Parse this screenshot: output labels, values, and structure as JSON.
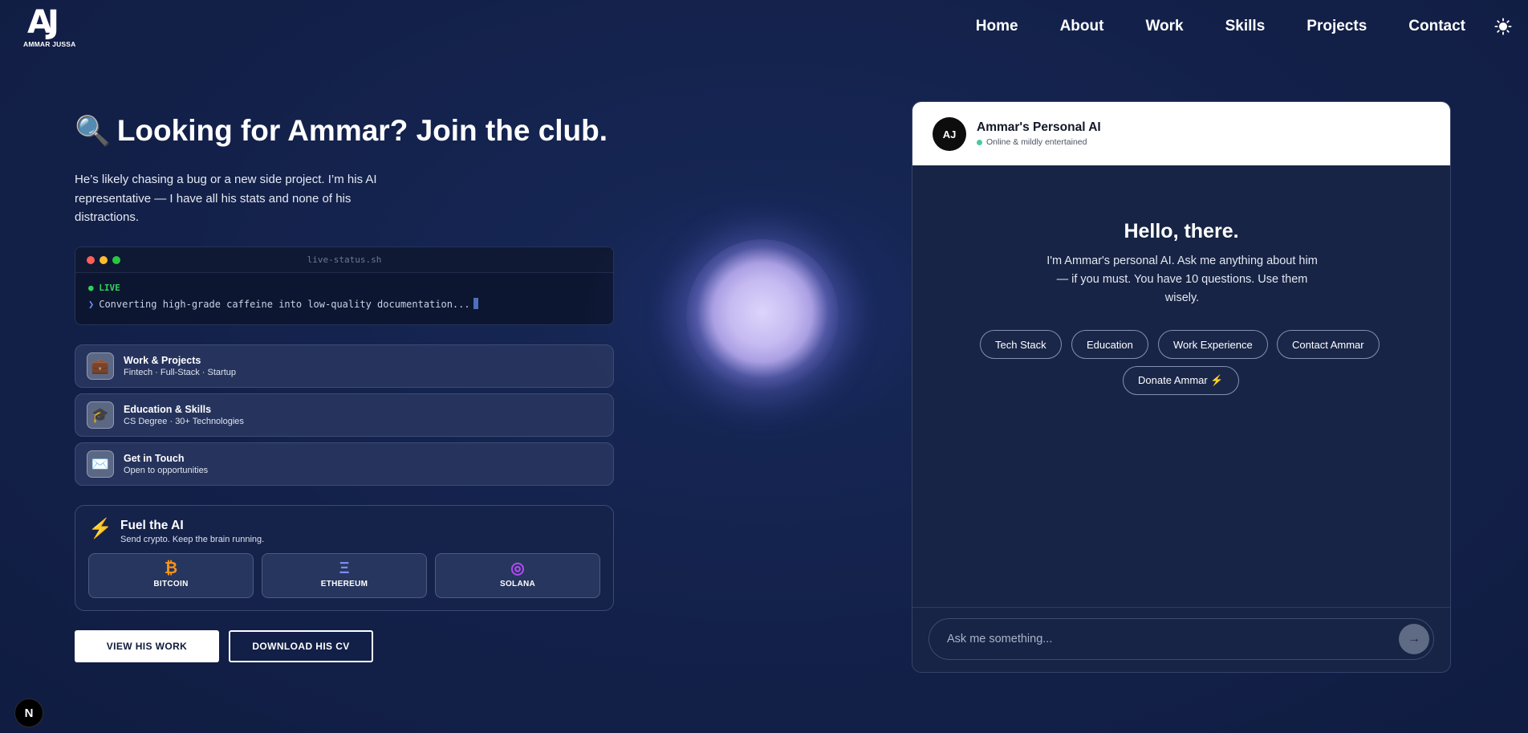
{
  "brand": {
    "mark": "AJ",
    "name": "AMMAR JUSSA"
  },
  "nav": {
    "items": [
      "Home",
      "About",
      "Work",
      "Skills",
      "Projects",
      "Contact"
    ],
    "theme_icon": "sun-icon"
  },
  "hero": {
    "icon": "🔍",
    "title": "Looking for Ammar? Join the club.",
    "subtitle": "He’s likely chasing a bug or a new side project. I’m his AI representative — I have all his stats and none of his distractions."
  },
  "terminal": {
    "filename": "live-status.sh",
    "live_label": "● LIVE",
    "prompt": "❯",
    "line": "Converting high-grade caffeine into low-quality documentation..."
  },
  "cards": [
    {
      "icon": "💼",
      "icon_name": "briefcase-icon",
      "title": "Work & Projects",
      "subtitle": "Fintech · Full-Stack · Startup"
    },
    {
      "icon": "🎓",
      "icon_name": "graduation-cap-icon",
      "title": "Education & Skills",
      "subtitle": "CS Degree · 30+ Technologies"
    },
    {
      "icon": "✉️",
      "icon_name": "envelope-icon",
      "title": "Get in Touch",
      "subtitle": "Open to opportunities"
    }
  ],
  "fuel": {
    "icon": "⚡",
    "title": "Fuel the AI",
    "subtitle": "Send crypto. Keep the brain running.",
    "coins": [
      {
        "symbol": "₿",
        "name": "BITCOIN",
        "color": "#f7931a"
      },
      {
        "symbol": "Ξ",
        "name": "ETHEREUM",
        "color": "#7b8cf0"
      },
      {
        "symbol": "◎",
        "name": "SOLANA",
        "color": "#b44cf5"
      }
    ]
  },
  "cta": {
    "primary": "VIEW HIS WORK",
    "secondary": "DOWNLOAD HIS CV"
  },
  "corner_badge": "N",
  "chat": {
    "avatar": "AJ",
    "name": "Ammar's Personal AI",
    "status": "Online & mildly entertained",
    "greeting": "Hello, there.",
    "intro": "I'm Ammar's personal AI. Ask me anything about him — if you must. You have 10 questions. Use them wisely.",
    "chips": [
      "Tech Stack",
      "Education",
      "Work Experience",
      "Contact Ammar",
      "Donate Ammar ⚡"
    ],
    "input_placeholder": "Ask me something...",
    "send_icon": "→"
  },
  "colors": {
    "background": "#13214a",
    "live": "#32d05a",
    "accent_bolt": "#f2c12e"
  }
}
